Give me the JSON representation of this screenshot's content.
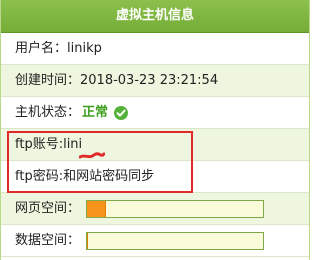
{
  "panel": {
    "title": "虚拟主机信息"
  },
  "rows": {
    "username": {
      "label": "用户名：",
      "value": "linikp"
    },
    "created": {
      "label": "创建时间：",
      "value": "2018-03-23 23:21:54"
    },
    "status": {
      "label": "主机状态：",
      "value": "正常",
      "icon": "check-circle-icon"
    },
    "ftp_account": {
      "label": "ftp账号:",
      "value": "lini"
    },
    "ftp_password": {
      "label": "ftp密码:",
      "value": "和网站密码同步"
    },
    "web_space": {
      "label": "网页空间：",
      "used_fraction": 0.11
    },
    "data_space": {
      "label": "数据空间：",
      "used_fraction": 0.0
    }
  },
  "colors": {
    "title_bar": "#7fb640",
    "alt_row": "#eef6df",
    "status_ok": "#3f9e1f",
    "highlight": "#e02a2a",
    "bar_fill": "#f7941d",
    "bar_bg": "#fafbd9"
  }
}
